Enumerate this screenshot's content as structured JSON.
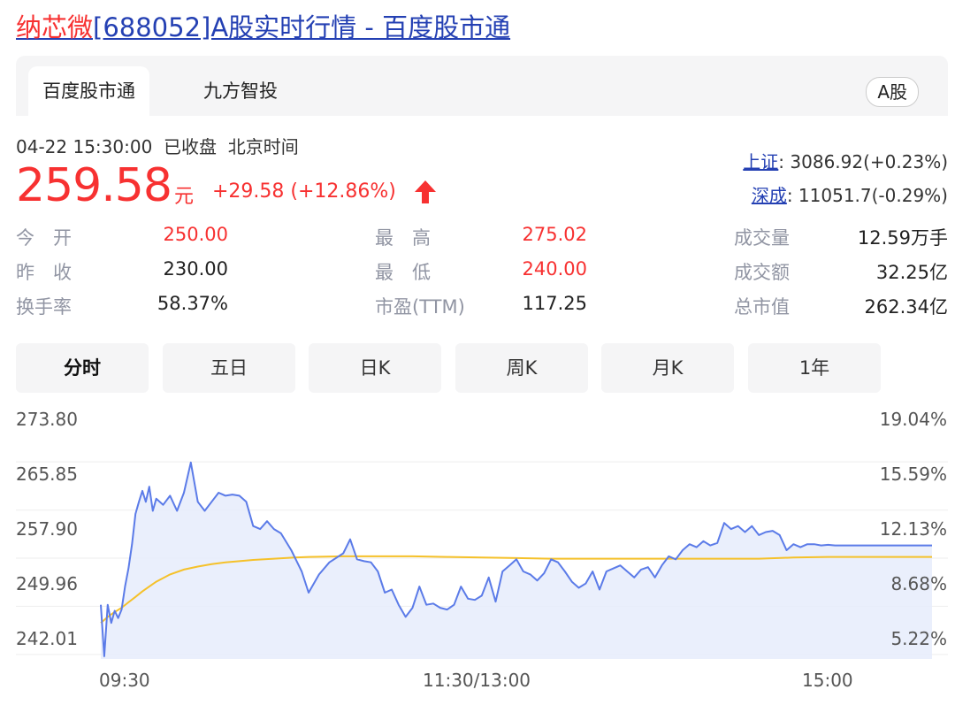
{
  "header": {
    "stock_name": "纳芯微",
    "title_rest": "[688052]A股实时行情 - 百度股市通"
  },
  "tabs": {
    "items": [
      "百度股市通",
      "九方智投"
    ],
    "market_button": "A股"
  },
  "status": {
    "datetime": "04-22 15:30:00",
    "state": "已收盘",
    "timezone": "北京时间"
  },
  "quote": {
    "price": "259.58",
    "unit": "元",
    "change": "+29.58 (+12.86%)",
    "direction_icon": "up-arrow-icon",
    "up_color": "#f73131"
  },
  "indices": [
    {
      "name": "上证",
      "value": ": 3086.92(+0.23%)"
    },
    {
      "name": "深成",
      "value": ": 11051.7(-0.29%)"
    }
  ],
  "stats": {
    "open_label": "今　开",
    "open": "250.00",
    "prev_label": "昨　收",
    "prev": "230.00",
    "turnover_label": "换手率",
    "turnover": "58.37%",
    "high_label": "最　高",
    "high": "275.02",
    "low_label": "最　低",
    "low": "240.00",
    "pe_label": "市盈(TTM)",
    "pe": "117.25",
    "volume_label": "成交量",
    "volume": "12.59万手",
    "amount_label": "成交额",
    "amount": "32.25亿",
    "mcap_label": "总市值",
    "mcap": "262.34亿"
  },
  "chart_tabs": [
    "分时",
    "五日",
    "日K",
    "周K",
    "月K",
    "1年"
  ],
  "chart_data": {
    "type": "line",
    "y_ticks": [
      "273.80",
      "265.85",
      "257.90",
      "249.96",
      "242.01"
    ],
    "pct_ticks": [
      "19.04%",
      "15.59%",
      "12.13%",
      "8.68%",
      "5.22%"
    ],
    "x_ticks": [
      "09:30",
      "11:30/13:00",
      "15:00"
    ],
    "ylim": [
      238.04,
      277.77
    ],
    "x_range": [
      0,
      240
    ],
    "prev_close": 230.0,
    "colors": {
      "price": "#5b7be8",
      "avg": "#f5c12a",
      "fill": "#e6ecfc"
    },
    "series": [
      {
        "role": "price",
        "x": [
          0,
          1,
          2,
          3,
          4,
          5,
          6,
          7,
          8,
          9,
          10,
          11,
          12,
          13,
          14,
          15,
          16,
          18,
          20,
          22,
          24,
          26,
          28,
          30,
          32,
          34,
          36,
          38,
          40,
          42,
          44,
          46,
          48,
          50,
          52,
          55,
          58,
          60,
          63,
          66,
          70,
          72,
          74,
          76,
          78,
          80,
          82,
          84,
          86,
          88,
          90,
          92,
          94,
          96,
          98,
          100,
          102,
          104,
          106,
          108,
          110,
          112,
          114,
          116,
          118,
          120,
          122,
          124,
          126,
          128,
          130,
          132,
          134,
          136,
          138,
          140,
          142,
          144,
          146,
          148,
          150,
          152,
          154,
          156,
          158,
          160,
          162,
          164,
          166,
          168,
          170,
          172,
          174,
          176,
          178,
          180,
          182,
          184,
          186,
          188,
          190,
          192,
          194,
          196,
          198,
          200,
          202,
          204,
          206,
          208,
          210,
          212,
          214,
          216,
          218,
          220,
          222,
          224,
          226,
          228,
          230,
          232,
          234,
          236,
          238,
          240
        ],
        "y": [
          247,
          238.5,
          247,
          244,
          246,
          244.8,
          246.2,
          250,
          253,
          257,
          262,
          264,
          265.8,
          264,
          266.5,
          262.5,
          264.5,
          263.5,
          265,
          262.5,
          265.5,
          270.5,
          264,
          262.5,
          264,
          265.5,
          265,
          265.2,
          265,
          264,
          260,
          259.5,
          260.8,
          259.5,
          258.8,
          256,
          252.5,
          249,
          252,
          254,
          255.5,
          257.8,
          254.5,
          254.2,
          254,
          252.5,
          249,
          249.5,
          247,
          245,
          246.5,
          250,
          247,
          247.2,
          246.5,
          246.2,
          247,
          250,
          248,
          247.8,
          248.5,
          251.5,
          247.5,
          252.5,
          253.5,
          254.5,
          252.5,
          252,
          251,
          252.2,
          254.5,
          254,
          252.5,
          250.8,
          249.8,
          250.5,
          252.5,
          249.5,
          252.5,
          253,
          253.5,
          252.5,
          251.5,
          252.8,
          253.2,
          251.5,
          253.5,
          255,
          254.5,
          256,
          257,
          256.5,
          257.5,
          256.8,
          257.2,
          260.5,
          259.5,
          260,
          259,
          260,
          258.5,
          259,
          259.2,
          258.5,
          256,
          257,
          256.5,
          257,
          257,
          256.8,
          256.9,
          256.8,
          256.8,
          256.8,
          256.8,
          256.8,
          256.8,
          256.8,
          256.8,
          256.8,
          256.8,
          256.8,
          256.8,
          256.8,
          256.8,
          256.8
        ]
      },
      {
        "role": "average",
        "x": [
          0,
          2,
          4,
          6,
          8,
          10,
          12,
          14,
          16,
          18,
          20,
          24,
          28,
          32,
          36,
          40,
          44,
          50,
          56,
          60,
          70,
          80,
          90,
          100,
          110,
          120,
          130,
          140,
          150,
          160,
          170,
          180,
          190,
          200,
          210,
          220,
          230,
          240
        ],
        "y": [
          244,
          245,
          245.8,
          246.5,
          247.4,
          248.3,
          249.2,
          250,
          250.8,
          251.4,
          252,
          252.8,
          253.3,
          253.7,
          254,
          254.2,
          254.4,
          254.6,
          254.8,
          254.9,
          255.0,
          255.0,
          255.0,
          254.9,
          254.8,
          254.7,
          254.6,
          254.6,
          254.6,
          254.6,
          254.6,
          254.6,
          254.6,
          254.8,
          254.9,
          254.9,
          254.9,
          254.9
        ]
      }
    ]
  }
}
